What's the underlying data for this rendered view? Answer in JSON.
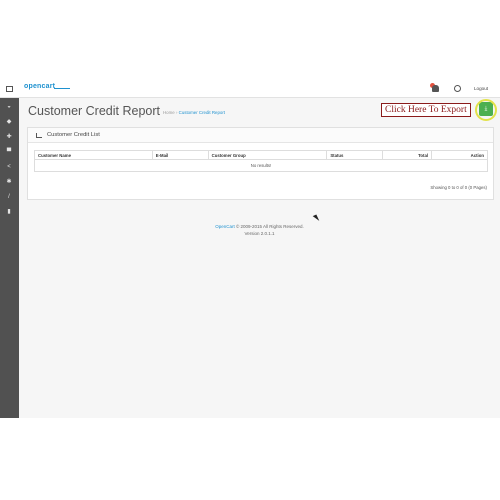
{
  "header": {
    "logo_text": "opencart",
    "logout_label": "Logout"
  },
  "sidebar": {
    "items": [
      {
        "icon": "dashboard-icon"
      },
      {
        "icon": "tag-icon"
      },
      {
        "icon": "puzzle-icon"
      },
      {
        "icon": "cart-icon"
      },
      {
        "icon": "share-icon"
      },
      {
        "icon": "gear-icon"
      },
      {
        "icon": "wrench-icon"
      },
      {
        "icon": "bar-chart-icon"
      }
    ]
  },
  "page": {
    "title": "Customer Credit Report",
    "breadcrumb_home": "Home",
    "breadcrumb_separator": "›",
    "breadcrumb_current": "Customer Credit Report",
    "export_label": "Click Here To Export"
  },
  "panel": {
    "title": "Customer Credit List",
    "columns": [
      "Customer Name",
      "E-Mail",
      "Customer Group",
      "Status",
      "Total",
      "Action"
    ],
    "empty_text": "No results!",
    "showing_text": "Showing 0 to 0 of 0 (0 Pages)"
  },
  "footer": {
    "link_text": "OpenCart",
    "copyright": " © 2009-2015 All Rights Reserved.",
    "version": "Version 2.0.1.1"
  },
  "colors": {
    "accent": "#1e91cf",
    "sidebar": "#515151",
    "export_button": "#4caf50",
    "export_label_border": "#8b1a1a"
  }
}
